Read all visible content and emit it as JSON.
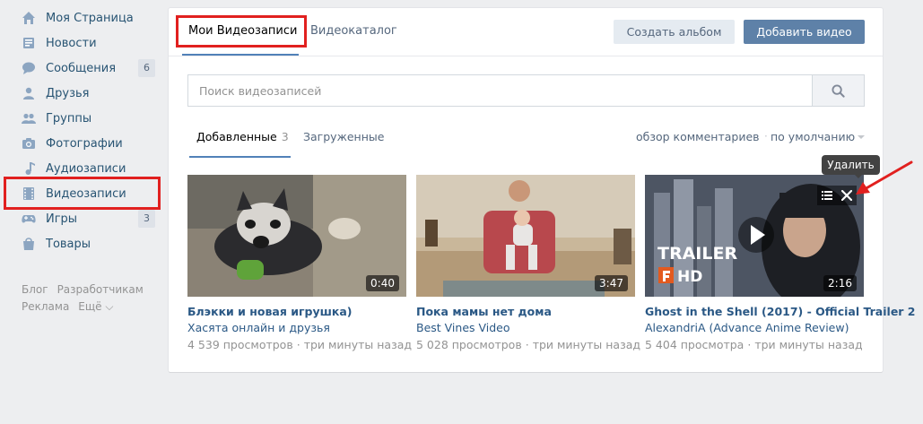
{
  "sidebar": {
    "items": [
      {
        "icon": "home-icon",
        "label": "Моя Страница",
        "count": ""
      },
      {
        "icon": "news-icon",
        "label": "Новости",
        "count": ""
      },
      {
        "icon": "messages-icon",
        "label": "Сообщения",
        "count": "6"
      },
      {
        "icon": "friends-icon",
        "label": "Друзья",
        "count": ""
      },
      {
        "icon": "groups-icon",
        "label": "Группы",
        "count": ""
      },
      {
        "icon": "photos-icon",
        "label": "Фотографии",
        "count": ""
      },
      {
        "icon": "music-icon",
        "label": "Аудиозаписи",
        "count": ""
      },
      {
        "icon": "video-icon",
        "label": "Видеозаписи",
        "count": ""
      },
      {
        "icon": "games-icon",
        "label": "Игры",
        "count": "3"
      },
      {
        "icon": "goods-icon",
        "label": "Товары",
        "count": ""
      }
    ],
    "footer": {
      "blog": "Блог",
      "developers": "Разработчикам",
      "ads": "Реклама",
      "more": "Ещё ⌵"
    }
  },
  "header": {
    "tab_my_videos": "Мои Видеозаписи",
    "tab_catalog": "Видеокаталог",
    "create_album": "Создать альбом",
    "add_video": "Добавить видео"
  },
  "search": {
    "placeholder": "Поиск видеозаписей"
  },
  "subtabs": {
    "added": "Добавленные",
    "added_count": "3",
    "uploaded": "Загруженные",
    "review_comments": "обзор комментариев",
    "sort": "по умолчанию"
  },
  "videos": [
    {
      "title": "Блэкки и новая игрушка)",
      "author": "Хасята онлайн и друзья",
      "views": "4 539 просмотров",
      "time": "три минуты назад",
      "duration": "0:40"
    },
    {
      "title": "Пока мамы нет дома",
      "author": "Best Vines Video",
      "views": "5 028 просмотров",
      "time": "три минуты назад",
      "duration": "3:47"
    },
    {
      "title": "Ghost in the Shell (2017) - Official Trailer 2",
      "author": "AlexandriA (Advance Anime Review)",
      "views": "5 404 просмотра",
      "time": "три минуты назад",
      "duration": "2:16",
      "thumb_text_1": "TRAILER",
      "thumb_text_2": "HD"
    }
  ],
  "tooltip": "Удалить",
  "colors": {
    "accent": "#5181b8",
    "link": "#2a5885",
    "highlight": "#e1201f"
  }
}
